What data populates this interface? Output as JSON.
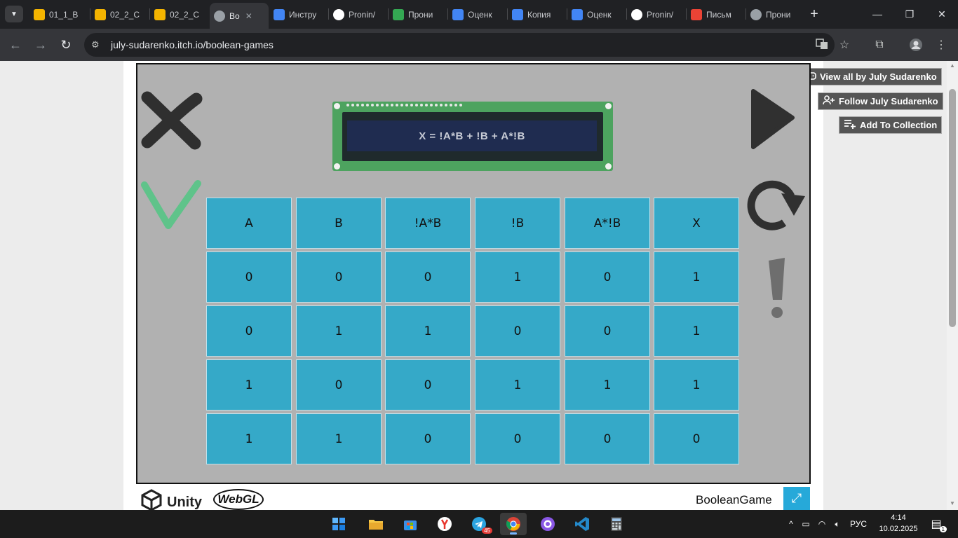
{
  "browser": {
    "tabs": [
      {
        "label": "01_1_B",
        "icon": "google-slides-icon",
        "color": "#f4b400"
      },
      {
        "label": "02_2_C",
        "icon": "google-slides-icon",
        "color": "#f4b400"
      },
      {
        "label": "02_2_C",
        "icon": "google-slides-icon",
        "color": "#f4b400"
      },
      {
        "label": "Bo",
        "icon": "globe-icon",
        "color": "#9aa0a6",
        "active": true
      },
      {
        "label": "Инстру",
        "icon": "google-docs-icon",
        "color": "#4285f4"
      },
      {
        "label": "Pronin/",
        "icon": "github-icon",
        "color": "#ffffff"
      },
      {
        "label": "Прони",
        "icon": "google-drive-icon",
        "color": "#34a853"
      },
      {
        "label": "Оценк",
        "icon": "google-docs-icon",
        "color": "#4285f4"
      },
      {
        "label": "Копия",
        "icon": "google-docs-icon",
        "color": "#4285f4"
      },
      {
        "label": "Оценк",
        "icon": "google-docs-icon",
        "color": "#4285f4"
      },
      {
        "label": "Pronin/",
        "icon": "github-icon",
        "color": "#ffffff"
      },
      {
        "label": "Письм",
        "icon": "gmail-icon",
        "color": "#ea4335"
      },
      {
        "label": "Прони",
        "icon": "globe-icon",
        "color": "#9aa0a6"
      }
    ],
    "url": "july-sudarenko.itch.io/boolean-games"
  },
  "itch": {
    "view_all": "View all by July Sudarenko",
    "follow": "Follow July Sudarenko",
    "add_collection": "Add To Collection"
  },
  "game": {
    "expression": "X = !A*B + !B + A*!B",
    "headers": [
      "A",
      "B",
      "!A*B",
      "!B",
      "A*!B",
      "X"
    ],
    "rows": [
      [
        "0",
        "0",
        "0",
        "1",
        "0",
        "1"
      ],
      [
        "0",
        "1",
        "1",
        "0",
        "0",
        "1"
      ],
      [
        "1",
        "0",
        "0",
        "1",
        "1",
        "1"
      ],
      [
        "1",
        "1",
        "0",
        "0",
        "0",
        "0"
      ]
    ],
    "title": "BooleanGame"
  },
  "footer": {
    "unity": "Unity",
    "webgl": "WebGL"
  },
  "taskbar": {
    "lang": "РУС",
    "time": "4:14",
    "date": "10.02.2025",
    "telegram_badge": "45",
    "notification_badge": "1"
  }
}
